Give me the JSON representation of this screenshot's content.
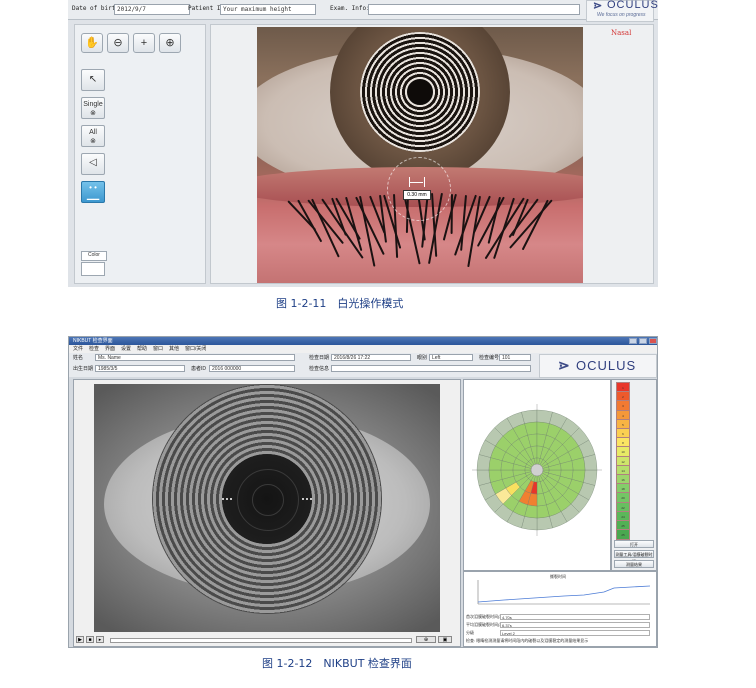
{
  "figure1": {
    "header": {
      "dob_label": "Date of birth:",
      "dob_value": "2012/9/7",
      "patient_id_label": "Patient ID:",
      "patient_id_value": "Your maximum height",
      "exam_info_label": "Exam. Info:",
      "exam_info_value": ""
    },
    "logo": {
      "brand": "OCULUS",
      "slogan": "We focus on progress"
    },
    "tools": {
      "zoom_fit": "✋",
      "zoom_out": "⊖",
      "move": "+",
      "zoom_in": "⊕",
      "pointer": "↖",
      "single_label": "Single",
      "all_label": "All",
      "color_label": "Color"
    },
    "image": {
      "orientation": "Nasal",
      "measure_value": "0.30 mm"
    }
  },
  "caption1": "图 1-2-11　白光操作模式",
  "figure2": {
    "titlebar": "NIKBUT 检查界面",
    "menu": [
      "文件",
      "检查",
      "界面",
      "设置",
      "帮助",
      "窗口",
      "其他",
      "窗口/关闭"
    ],
    "info": {
      "name_label": "姓名",
      "name_value": "Ms. Name",
      "dob_label": "出生日期",
      "dob_value": "1985/3/5",
      "id_label": "患者ID",
      "id_value": "2016 000000",
      "exam_date_label": "检查日期",
      "exam_date_value": "2016/8/26 17:22",
      "exam_info_label": "检查信息",
      "eye_label": "眼别",
      "eye_value": "Left",
      "exam_no_label": "检查编号",
      "exam_no_value": "101"
    },
    "logo": {
      "brand": "OCULUS"
    },
    "legend": {
      "labels": [
        "1",
        "2",
        "3",
        "4",
        "5",
        "6",
        "8",
        "10",
        "12",
        "14",
        "16",
        "18",
        "20",
        "22",
        "24",
        "25",
        "25"
      ],
      "colors": [
        "#e8362a",
        "#ee5a2c",
        "#f27a32",
        "#f5983a",
        "#f8b444",
        "#fbcf52",
        "#fbe463",
        "#e8ea66",
        "#cfe56a",
        "#b6de6c",
        "#9dd56c",
        "#84cd6a",
        "#74c565",
        "#68be60",
        "#5cb75a",
        "#52b055",
        "#4aa850"
      ],
      "btn1": "打开",
      "btn2": "测量工具/泪膜破裂时间",
      "btn3": "测量结果"
    },
    "graph": {
      "title": "撕裂时间",
      "result_labels": [
        "首次泪膜破裂时间(秒)",
        "平均泪膜破裂时间(秒)",
        "分级"
      ],
      "result_values": [
        "4.70s",
        "6.37s",
        "Level 2"
      ],
      "note": "检查: 眼睛检测测量请将时间段内的破裂以及泪膜稳定的测量结果显示"
    }
  },
  "caption2": "图 1-2-12　NIKBUT 检查界面"
}
